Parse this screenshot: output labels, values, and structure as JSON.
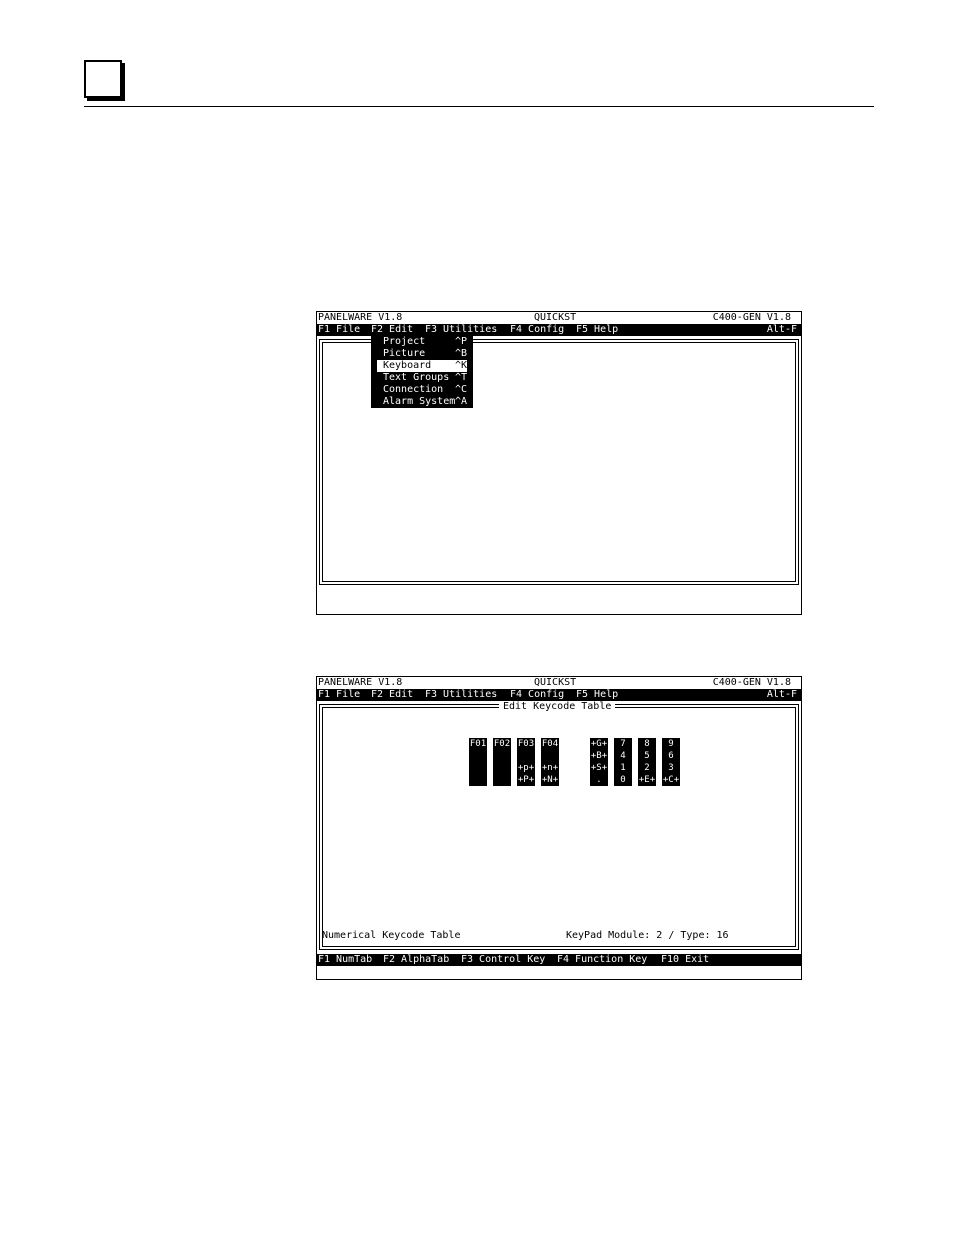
{
  "screen1": {
    "title_left": "PANELWARE V1.8",
    "title_center": "QUICKST",
    "title_right": "C400-GEN V1.8",
    "menu": [
      {
        "label": "F1 File"
      },
      {
        "label": "F2 Edit"
      },
      {
        "label": "F3 Utilities"
      },
      {
        "label": "F4 Config"
      },
      {
        "label": "F5 Help"
      }
    ],
    "menu_shortcut": "Alt-F",
    "dropdown": [
      {
        "label": "Project",
        "key": "^P"
      },
      {
        "label": "Picture",
        "key": "^B"
      },
      {
        "label": "Keyboard",
        "key": "^K"
      },
      {
        "label": "Text Groups",
        "key": "^T"
      },
      {
        "label": "Connection",
        "key": "^C"
      },
      {
        "label": "Alarm System",
        "key": "^A"
      }
    ]
  },
  "screen2": {
    "title_left": "PANELWARE V1.8",
    "title_center": "QUICKST",
    "title_right": "C400-GEN V1.8",
    "menu": [
      {
        "label": "F1 File"
      },
      {
        "label": "F2 Edit"
      },
      {
        "label": "F3 Utilities"
      },
      {
        "label": "F4 Config"
      },
      {
        "label": "F5 Help"
      }
    ],
    "menu_shortcut": "Alt-F",
    "window_title": "Edit Keycode Table",
    "keys": [
      {
        "rows": [
          "F01",
          "",
          "",
          ""
        ]
      },
      {
        "rows": [
          "F02",
          "",
          "",
          ""
        ]
      },
      {
        "rows": [
          "F03",
          "",
          "+p+",
          "+P+"
        ]
      },
      {
        "rows": [
          "F04",
          "",
          "+n+",
          "+N+"
        ]
      },
      {
        "rows": [
          "+G+",
          "+B+",
          "+S+",
          "."
        ]
      },
      {
        "rows": [
          "7",
          "4",
          "1",
          "0"
        ]
      },
      {
        "rows": [
          "8",
          "5",
          "2",
          "+E+"
        ]
      },
      {
        "rows": [
          "9",
          "6",
          "3",
          "+C+"
        ]
      }
    ],
    "footer_left": "Numerical Keycode Table",
    "footer_right": "KeyPad Module: 2 / Type: 16",
    "status": [
      {
        "label": "F1 NumTab"
      },
      {
        "label": "F2 AlphaTab"
      },
      {
        "label": "F3 Control Key"
      },
      {
        "label": "F4 Function Key"
      },
      {
        "label": "F10 Exit"
      }
    ]
  }
}
